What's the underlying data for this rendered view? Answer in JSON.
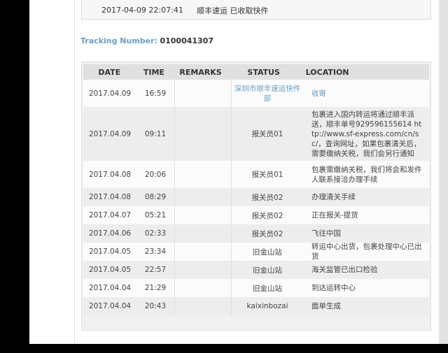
{
  "top_entry": {
    "datetime": "2017-04-09 22:07:41",
    "text": "顺丰速运 已收取快件"
  },
  "tracking": {
    "label": "Tracking Number:",
    "number": "0100041307"
  },
  "table": {
    "headers": {
      "date": "DATE",
      "time": "TIME",
      "remarks": "REMARKS",
      "status": "STATUS",
      "location": "LOCATION"
    },
    "rows": [
      {
        "date": "2017.04.09",
        "time": "16:59",
        "remarks": "",
        "status": "深圳市顺丰速运快件部",
        "location": "收寄"
      },
      {
        "date": "2017.04.09",
        "time": "09:11",
        "remarks": "",
        "status": "报关员01",
        "location": "包裹进入国内转运将通过顺丰派送，顺丰单号929596155614 http://www.sf-express.com/cn/sc/，查询网址，如果包裹清关后，需要缴纳关税，我们会另行通知"
      },
      {
        "date": "2017.04.08",
        "time": "20:06",
        "remarks": "",
        "status": "报关员01",
        "location": "包裹需缴纳关税，我们将会和发件人联系接洽办理手续"
      },
      {
        "date": "2017.04.08",
        "time": "08:29",
        "remarks": "",
        "status": "报关员02",
        "location": "办理清关手续"
      },
      {
        "date": "2017.04.07",
        "time": "05:21",
        "remarks": "",
        "status": "报关员02",
        "location": "正在报关-提货"
      },
      {
        "date": "2017.04.06",
        "time": "02:33",
        "remarks": "",
        "status": "报关员02",
        "location": "飞往中国"
      },
      {
        "date": "2017.04.05",
        "time": "23:34",
        "remarks": "",
        "status": "旧金山站",
        "location": "转运中心出货，包裹处理中心已出货"
      },
      {
        "date": "2017.04.05",
        "time": "22:57",
        "remarks": "",
        "status": "旧金山站",
        "location": "海关监管已出口检验"
      },
      {
        "date": "2017.04.04",
        "time": "21:29",
        "remarks": "",
        "status": "旧金山站",
        "location": "到达运转中心"
      },
      {
        "date": "2017.04.04",
        "time": "20:43",
        "remarks": "",
        "status": "kaixinbozai",
        "location": "面单生成"
      }
    ]
  },
  "colors": {
    "accent": "#6a9dc6",
    "header_bg": "#e0e0e0",
    "row_alt": "#ededed"
  }
}
